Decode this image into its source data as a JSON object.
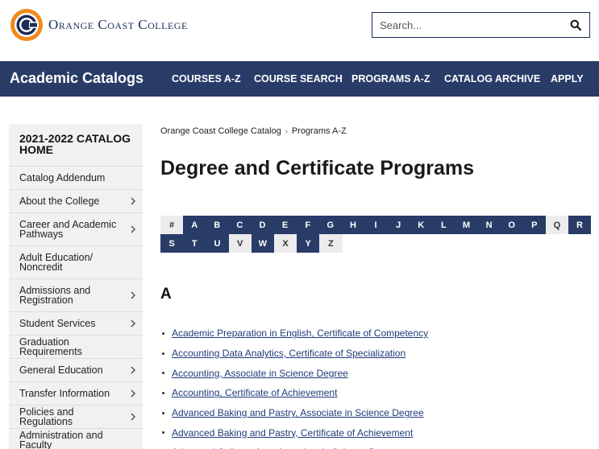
{
  "header": {
    "logo_text": "Orange Coast College",
    "search_placeholder": "Search...",
    "search_icon": "magnifier"
  },
  "navbar": {
    "brand": "Academic Catalogs",
    "links": [
      "COURSES A-Z",
      "COURSE SEARCH",
      "PROGRAMS A-Z",
      "CATALOG ARCHIVE",
      "APPLY"
    ]
  },
  "sidebar": {
    "home": "2021-2022 CATALOG HOME",
    "items": [
      {
        "label": "Catalog Addendum",
        "expandable": false
      },
      {
        "label": "About the College",
        "expandable": true
      },
      {
        "label": "Career and Academic Pathways",
        "expandable": true
      },
      {
        "label": "Adult Education/ Noncredit",
        "expandable": false
      },
      {
        "label": "Admissions and Registration",
        "expandable": true
      },
      {
        "label": "Student Services",
        "expandable": true
      },
      {
        "label": "Graduation Requirements",
        "expandable": false
      },
      {
        "label": "General Education",
        "expandable": true
      },
      {
        "label": "Transfer Information",
        "expandable": true
      },
      {
        "label": "Policies and Regulations",
        "expandable": true
      },
      {
        "label": "Administration and Faculty",
        "expandable": false
      }
    ]
  },
  "breadcrumb": {
    "parent": "Orange Coast College Catalog",
    "separator": "›",
    "current": "Programs A-Z"
  },
  "page_title": "Degree and Certificate Programs",
  "letter_index": {
    "row1": [
      {
        "l": "#",
        "active": false
      },
      {
        "l": "A",
        "active": true
      },
      {
        "l": "B",
        "active": true
      },
      {
        "l": "C",
        "active": true
      },
      {
        "l": "D",
        "active": true
      },
      {
        "l": "E",
        "active": true
      },
      {
        "l": "F",
        "active": true
      },
      {
        "l": "G",
        "active": true
      },
      {
        "l": "H",
        "active": true
      },
      {
        "l": "I",
        "active": true
      },
      {
        "l": "J",
        "active": true
      },
      {
        "l": "K",
        "active": true
      },
      {
        "l": "L",
        "active": true
      },
      {
        "l": "M",
        "active": true
      },
      {
        "l": "N",
        "active": true
      },
      {
        "l": "O",
        "active": true
      },
      {
        "l": "P",
        "active": true
      },
      {
        "l": "Q",
        "active": false
      },
      {
        "l": "R",
        "active": true
      }
    ],
    "row2": [
      {
        "l": "S",
        "active": true
      },
      {
        "l": "T",
        "active": true
      },
      {
        "l": "U",
        "active": true
      },
      {
        "l": "V",
        "active": false
      },
      {
        "l": "W",
        "active": true
      },
      {
        "l": "X",
        "active": false
      },
      {
        "l": "Y",
        "active": true
      },
      {
        "l": "Z",
        "active": false
      }
    ]
  },
  "section_heading": "A",
  "programs": [
    "Academic Preparation in English, Certificate of Competency",
    "Accounting Data Analytics, Certificate of Specialization",
    "Accounting, Associate in Science Degree",
    "Accounting, Certificate of Achievement",
    "Advanced Baking and Pastry, Associate in Science Degree",
    "Advanced Baking and Pastry, Certificate of Achievement",
    "Advanced Culinary Arts, Associate in Science Degree"
  ],
  "colors": {
    "navy": "#293c67",
    "sidebar_bg": "#f1f1f1",
    "logo_orange": "#f08a1c",
    "link": "#1f3b7a"
  }
}
